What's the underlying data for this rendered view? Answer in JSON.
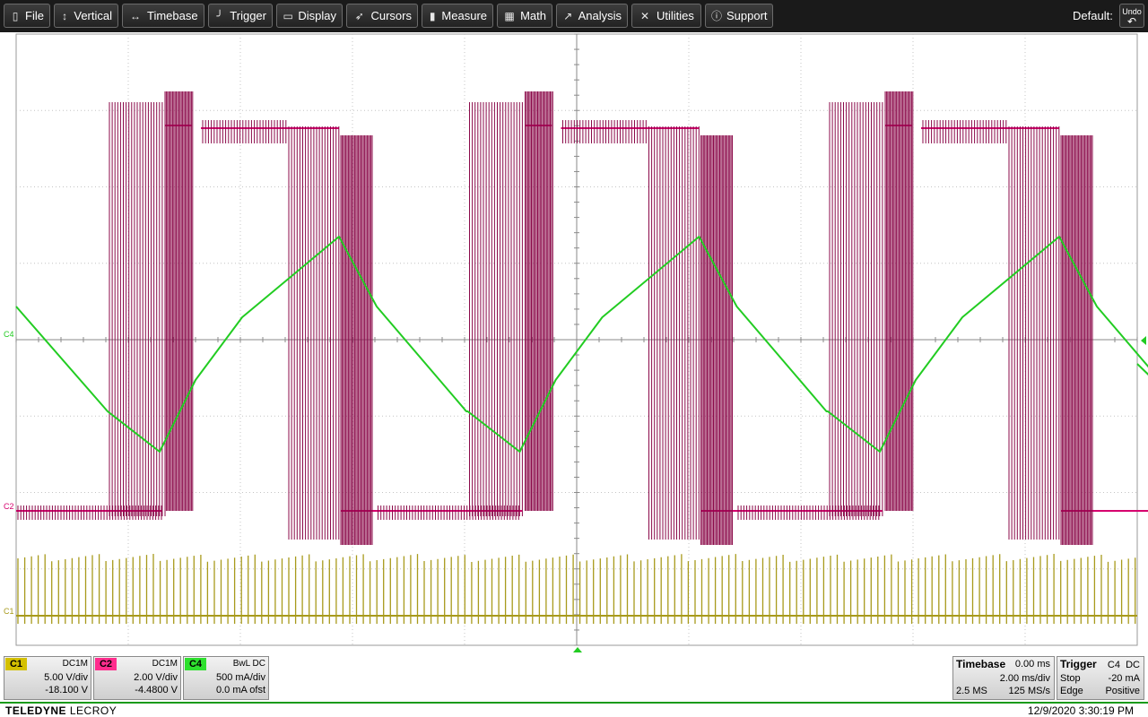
{
  "menu": {
    "items": [
      {
        "label": "File",
        "icon": "clipboard-icon"
      },
      {
        "label": "Vertical",
        "icon": "vertical-arrows-icon"
      },
      {
        "label": "Timebase",
        "icon": "horizontal-arrows-icon"
      },
      {
        "label": "Trigger",
        "icon": "trigger-icon"
      },
      {
        "label": "Display",
        "icon": "monitor-icon"
      },
      {
        "label": "Cursors",
        "icon": "cursor-icon"
      },
      {
        "label": "Measure",
        "icon": "measure-icon"
      },
      {
        "label": "Math",
        "icon": "calculator-icon"
      },
      {
        "label": "Analysis",
        "icon": "chart-icon"
      },
      {
        "label": "Utilities",
        "icon": "tools-icon"
      },
      {
        "label": "Support",
        "icon": "info-icon"
      }
    ],
    "default_label": "Default:",
    "undo_label": "Undo"
  },
  "markers": {
    "c4": "C4",
    "c2": "C2",
    "c1": "C1"
  },
  "colors": {
    "c1": "#a89a1c",
    "c2": "#d6006e",
    "c2_burst": "#8b0a4a",
    "c4": "#22cc22",
    "grid": "#b0b0b0"
  },
  "channels": [
    {
      "tag": "C1",
      "coupling": "DC1M",
      "scale": "5.00 V/div",
      "offset": "-18.100 V",
      "color": "#d4c000"
    },
    {
      "tag": "C2",
      "coupling": "DC1M",
      "scale": "2.00 V/div",
      "offset": "-4.4800 V",
      "color": "#ff2d8d"
    },
    {
      "tag": "C4",
      "coupling": "BwL DC",
      "scale": "500 mA/div",
      "offset": "0.0 mA ofst",
      "color": "#2ee02e"
    }
  ],
  "timebase": {
    "title": "Timebase",
    "delay": "0.00 ms",
    "scale": "2.00 ms/div",
    "samples": "2.5 MS",
    "rate": "125 MS/s"
  },
  "trigger": {
    "title": "Trigger",
    "source": "C4",
    "coupling": "DC",
    "mode": "Stop",
    "level": "-20 mA",
    "type": "Edge",
    "slope": "Positive"
  },
  "status": {
    "brand_bold": "TELEDYNE",
    "brand_thin": "LECROY",
    "datetime": "12/9/2020 3:30:19 PM"
  }
}
